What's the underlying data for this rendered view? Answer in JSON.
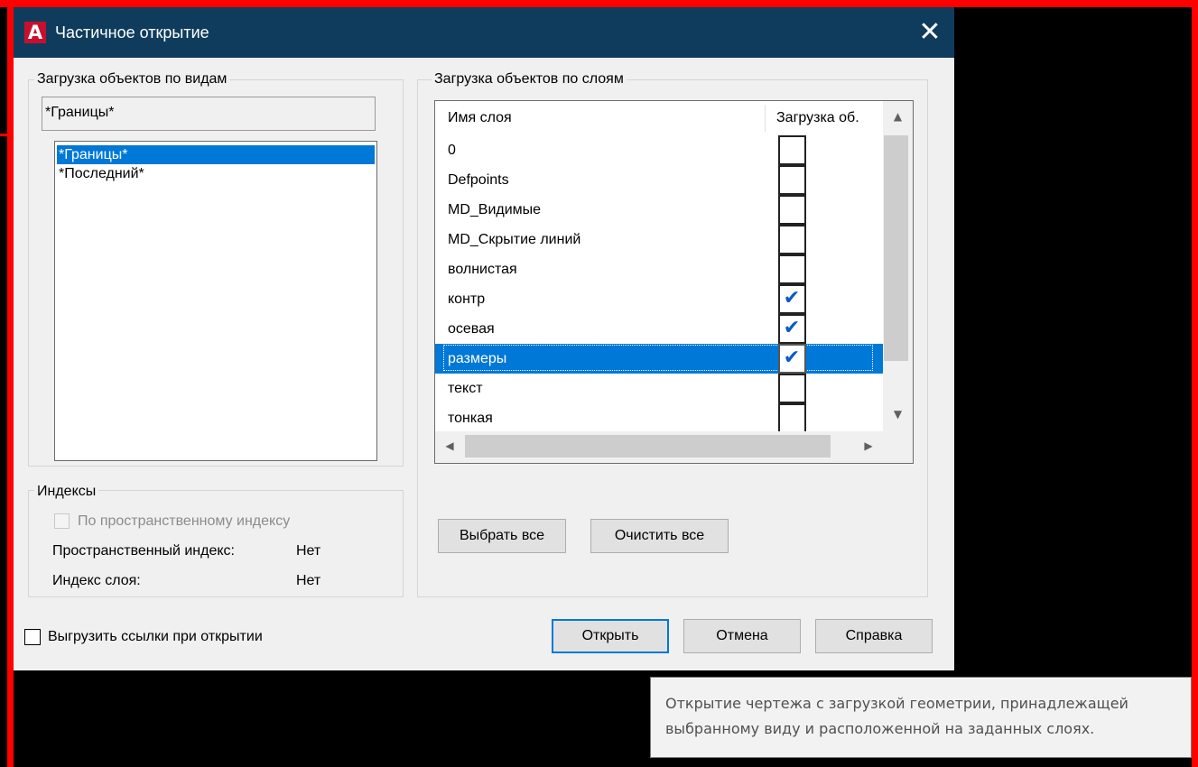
{
  "window": {
    "title": "Частичное открытие",
    "app_icon_letter": "A",
    "close_glyph": "✕"
  },
  "views_group": {
    "label": "Загрузка объектов по видам",
    "current_view": "*Границы*",
    "items": [
      {
        "label": "*Границы*",
        "selected": true
      },
      {
        "label": "*Последний*",
        "selected": false
      }
    ]
  },
  "index_group": {
    "label": "Индексы",
    "spatial_checkbox_label": "По пространственному индексу",
    "spatial_index_label": "Пространственный индекс:",
    "spatial_index_value": "Нет",
    "layer_index_label": "Индекс слоя:",
    "layer_index_value": "Нет"
  },
  "layers_group": {
    "label": "Загрузка объектов по слоям",
    "columns": [
      "Имя слоя",
      "Загрузка об."
    ],
    "rows": [
      {
        "name": "0",
        "checked": false,
        "selected": false
      },
      {
        "name": "Defpoints",
        "checked": false,
        "selected": false
      },
      {
        "name": "MD_Видимые",
        "checked": false,
        "selected": false
      },
      {
        "name": "MD_Скрытие линий",
        "checked": false,
        "selected": false
      },
      {
        "name": "волнистая",
        "checked": false,
        "selected": false
      },
      {
        "name": "контр",
        "checked": true,
        "selected": false
      },
      {
        "name": "осевая",
        "checked": true,
        "selected": false
      },
      {
        "name": "размеры",
        "checked": true,
        "selected": true
      },
      {
        "name": "текст",
        "checked": false,
        "selected": false
      },
      {
        "name": "тонкая",
        "checked": false,
        "selected": false
      }
    ],
    "select_all": "Выбрать все",
    "clear_all": "Очистить все"
  },
  "unload_refs_label": "Выгрузить ссылки при открытии",
  "buttons": {
    "open": "Открыть",
    "cancel": "Отмена",
    "help": "Справка"
  },
  "tooltip": {
    "line1": "Открытие чертежа с загрузкой геометрии, принадлежащей",
    "line2": "выбранному виду и расположенной на заданных слоях."
  },
  "icons": {
    "check": "✔",
    "arrow_up": "▲",
    "arrow_down": "▼",
    "arrow_left": "◀",
    "arrow_right": "▶"
  },
  "colors": {
    "title_bar": "#0f3c5c",
    "selection": "#0078d7",
    "annotation_frame": "#ff0000"
  }
}
